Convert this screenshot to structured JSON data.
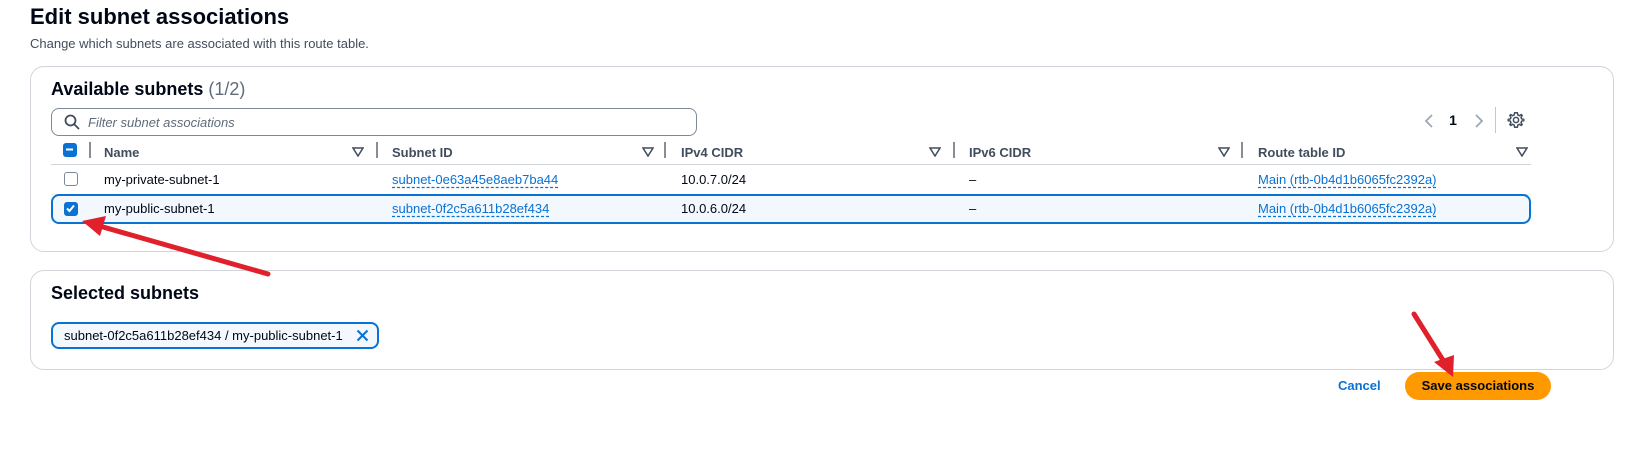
{
  "page": {
    "title": "Edit subnet associations",
    "description": "Change which subnets are associated with this route table."
  },
  "available": {
    "heading": "Available subnets",
    "count": "(1/2)",
    "filter_placeholder": "Filter subnet associations",
    "pagination": {
      "current_page": "1"
    },
    "columns": [
      "Name",
      "Subnet ID",
      "IPv4 CIDR",
      "IPv6 CIDR",
      "Route table ID"
    ],
    "rows": [
      {
        "name": "my-private-subnet-1",
        "subnet_id": "subnet-0e63a45e8aeb7ba44",
        "ipv4": "10.0.7.0/24",
        "ipv6": "–",
        "route_table": "Main (rtb-0b4d1b6065fc2392a)",
        "selected": false
      },
      {
        "name": "my-public-subnet-1",
        "subnet_id": "subnet-0f2c5a611b28ef434",
        "ipv4": "10.0.6.0/24",
        "ipv6": "–",
        "route_table": "Main (rtb-0b4d1b6065fc2392a)",
        "selected": true
      }
    ]
  },
  "selected": {
    "heading": "Selected subnets",
    "tokens": [
      "subnet-0f2c5a611b28ef434 / my-public-subnet-1"
    ]
  },
  "actions": {
    "cancel_label": "Cancel",
    "save_label": "Save associations"
  },
  "colors": {
    "accent": "#0972d3",
    "primary_button": "#ff9900",
    "annotation_arrow": "#e0202a"
  }
}
